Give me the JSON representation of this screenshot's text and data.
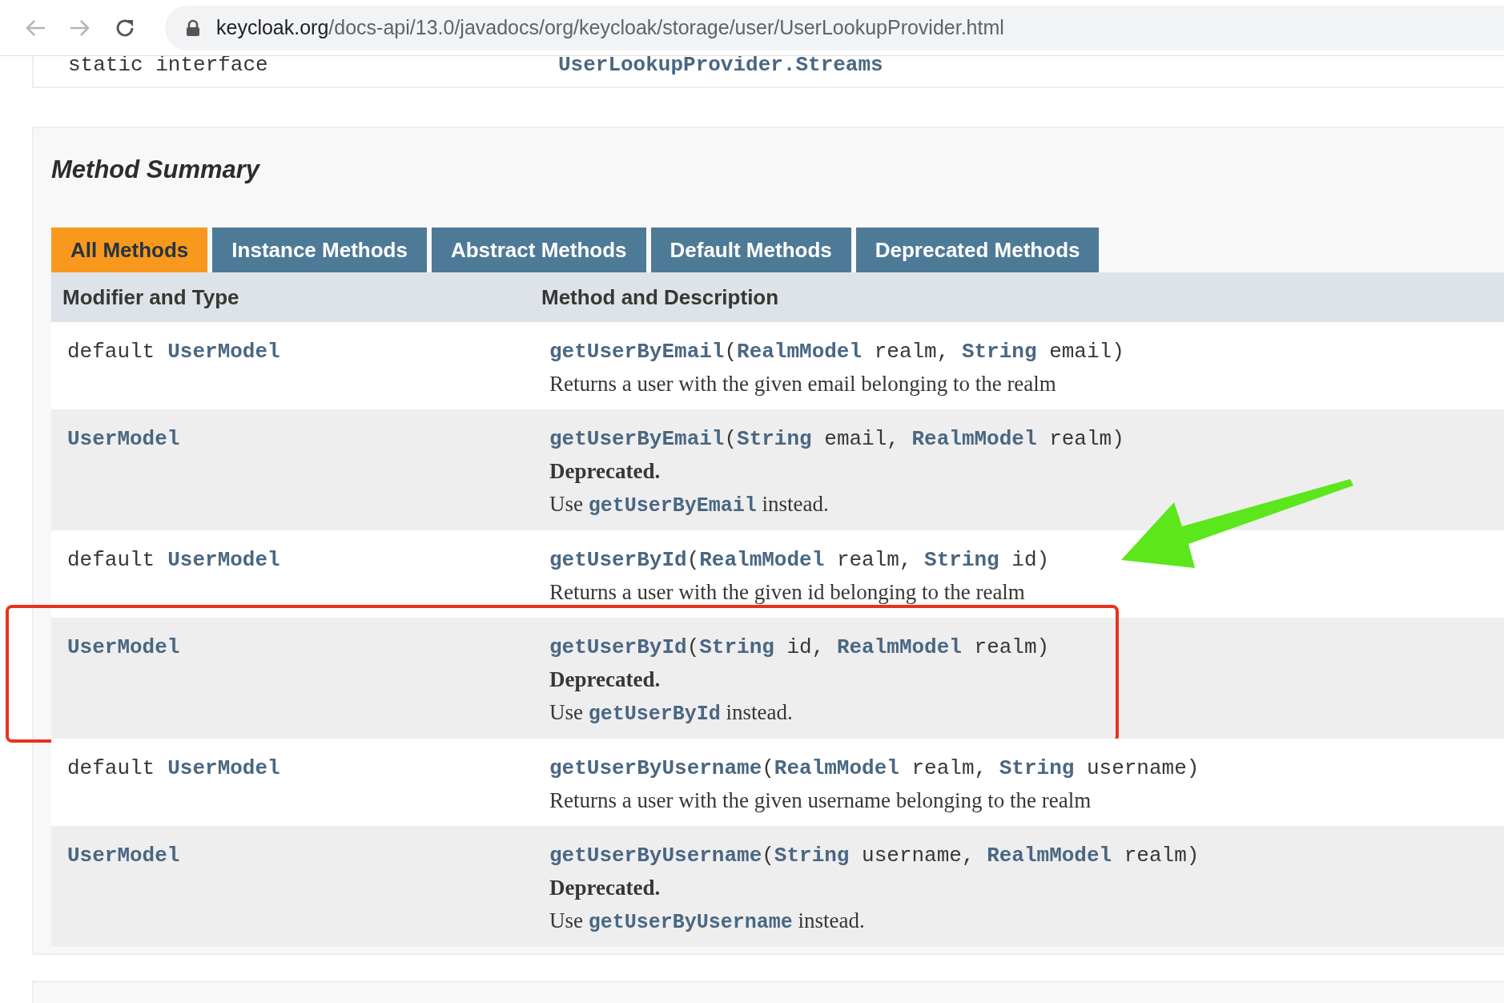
{
  "browser": {
    "url_host": "keycloak.org",
    "url_path": "/docs-api/13.0/javadocs/org/keycloak/storage/user/UserLookupProvider.html"
  },
  "nested_row": {
    "modifier": "static interface",
    "type": "UserLookupProvider.Streams"
  },
  "method_summary": {
    "title": "Method Summary",
    "tabs": [
      {
        "label": "All Methods",
        "selected": true
      },
      {
        "label": "Instance Methods",
        "selected": false
      },
      {
        "label": "Abstract Methods",
        "selected": false
      },
      {
        "label": "Default Methods",
        "selected": false
      },
      {
        "label": "Deprecated Methods",
        "selected": false
      }
    ],
    "columns": [
      "Modifier and Type",
      "Method and Description"
    ],
    "rows": [
      {
        "modifier": "default",
        "type": "UserModel",
        "signature": [
          {
            "kind": "method",
            "text": "getUserByEmail"
          },
          {
            "kind": "plain",
            "text": "("
          },
          {
            "kind": "type",
            "text": "RealmModel"
          },
          {
            "kind": "plain",
            "text": " realm, "
          },
          {
            "kind": "type",
            "text": "String"
          },
          {
            "kind": "plain",
            "text": " email)"
          }
        ],
        "deprecated": false,
        "description": "Returns a user with the given email belonging to the realm",
        "highlighted": false,
        "pointed": false
      },
      {
        "type": "UserModel",
        "signature": [
          {
            "kind": "method",
            "text": "getUserByEmail"
          },
          {
            "kind": "plain",
            "text": "("
          },
          {
            "kind": "type",
            "text": "String"
          },
          {
            "kind": "plain",
            "text": " email, "
          },
          {
            "kind": "type",
            "text": "RealmModel"
          },
          {
            "kind": "plain",
            "text": " realm)"
          }
        ],
        "deprecated": true,
        "deprecated_label": "Deprecated.",
        "use_before": "Use",
        "use_link": "getUserByEmail",
        "use_after": "instead.",
        "highlighted": false,
        "pointed": false
      },
      {
        "modifier": "default",
        "type": "UserModel",
        "signature": [
          {
            "kind": "method",
            "text": "getUserById"
          },
          {
            "kind": "plain",
            "text": "("
          },
          {
            "kind": "type",
            "text": "RealmModel"
          },
          {
            "kind": "plain",
            "text": " realm, "
          },
          {
            "kind": "type",
            "text": "String"
          },
          {
            "kind": "plain",
            "text": " id)"
          }
        ],
        "deprecated": false,
        "description": "Returns a user with the given id belonging to the realm",
        "highlighted": false,
        "pointed": true
      },
      {
        "type": "UserModel",
        "signature": [
          {
            "kind": "method",
            "text": "getUserById"
          },
          {
            "kind": "plain",
            "text": "("
          },
          {
            "kind": "type",
            "text": "String"
          },
          {
            "kind": "plain",
            "text": " id, "
          },
          {
            "kind": "type",
            "text": "RealmModel"
          },
          {
            "kind": "plain",
            "text": " realm)"
          }
        ],
        "deprecated": true,
        "deprecated_label": "Deprecated.",
        "use_before": "Use",
        "use_link": "getUserById",
        "use_after": "instead.",
        "highlighted": true,
        "pointed": false
      },
      {
        "modifier": "default",
        "type": "UserModel",
        "signature": [
          {
            "kind": "method",
            "text": "getUserByUsername"
          },
          {
            "kind": "plain",
            "text": "("
          },
          {
            "kind": "type",
            "text": "RealmModel"
          },
          {
            "kind": "plain",
            "text": " realm, "
          },
          {
            "kind": "type",
            "text": "String"
          },
          {
            "kind": "plain",
            "text": " username)"
          }
        ],
        "deprecated": false,
        "description": "Returns a user with the given username belonging to the realm",
        "highlighted": false,
        "pointed": false
      },
      {
        "type": "UserModel",
        "signature": [
          {
            "kind": "method",
            "text": "getUserByUsername"
          },
          {
            "kind": "plain",
            "text": "("
          },
          {
            "kind": "type",
            "text": "String"
          },
          {
            "kind": "plain",
            "text": " username, "
          },
          {
            "kind": "type",
            "text": "RealmModel"
          },
          {
            "kind": "plain",
            "text": " realm)"
          }
        ],
        "deprecated": true,
        "deprecated_label": "Deprecated.",
        "use_before": "Use",
        "use_link": "getUserByUsername",
        "use_after": "instead.",
        "highlighted": false,
        "pointed": false
      }
    ]
  }
}
